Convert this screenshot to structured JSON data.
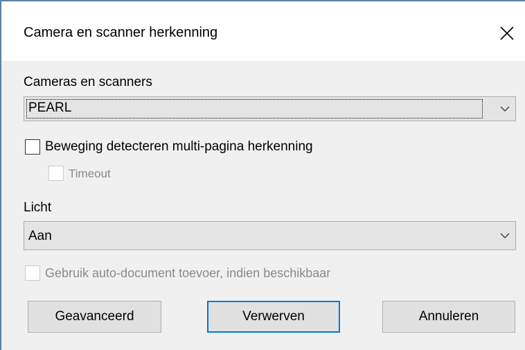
{
  "window": {
    "title": "Camera en scanner herkenning",
    "close_icon": "close-icon"
  },
  "devices": {
    "label": "Cameras en scanners",
    "selected": "PEARL"
  },
  "motion": {
    "label": "Beweging detecteren multi-pagina herkenning",
    "checked": false
  },
  "timeout": {
    "label": "Timeout",
    "checked": false,
    "enabled": false
  },
  "light": {
    "label": "Licht",
    "selected": "Aan"
  },
  "adf": {
    "label": "Gebruik auto-document toevoer, indien beschikbaar",
    "checked": false,
    "enabled": false
  },
  "buttons": {
    "advanced": "Geavanceerd",
    "acquire": "Verwerven",
    "cancel": "Annuleren"
  },
  "colors": {
    "accent": "#0078d7",
    "window_border": "#5a7fa8",
    "dialog_bg": "#f0f0f0",
    "disabled_text": "#8a8a8a"
  }
}
